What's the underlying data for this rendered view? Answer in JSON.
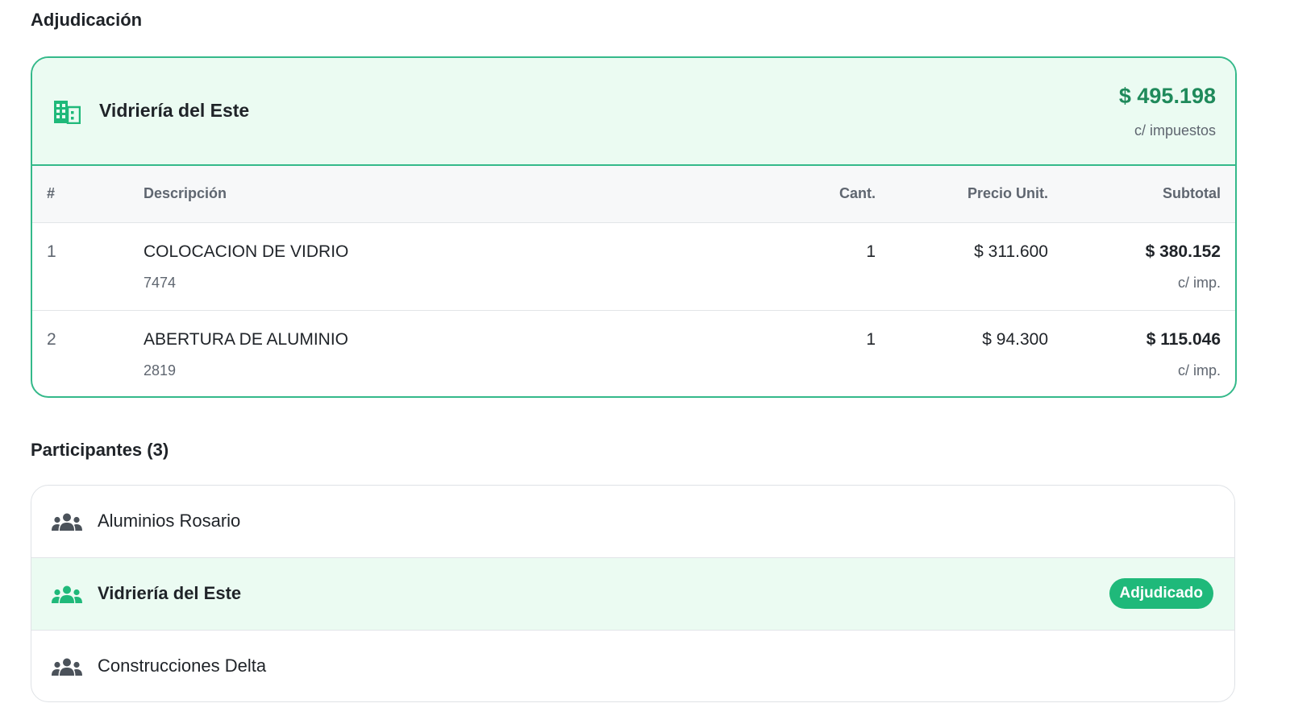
{
  "award": {
    "section_title": "Adjudicación",
    "vendor": "Vidriería del Este",
    "total": "$ 495.198",
    "tax_note": "c/ impuestos",
    "icon": "building-icon",
    "columns": {
      "num": "#",
      "desc": "Descripción",
      "qty": "Cant.",
      "price": "Precio Unit.",
      "subtotal": "Subtotal"
    },
    "items": [
      {
        "num": "1",
        "desc": "COLOCACION DE VIDRIO",
        "code": "7474",
        "qty": "1",
        "price": "$ 311.600",
        "subtotal": "$ 380.152",
        "subtotal_note": "c/ imp."
      },
      {
        "num": "2",
        "desc": "ABERTURA DE ALUMINIO",
        "code": "2819",
        "qty": "1",
        "price": "$ 94.300",
        "subtotal": "$ 115.046",
        "subtotal_note": "c/ imp."
      }
    ]
  },
  "participants": {
    "section_title": "Participantes (3)",
    "icon": "users-icon",
    "list": [
      {
        "name": "Aluminios Rosario"
      },
      {
        "name": "Vidriería del Este",
        "badge": "Adjudicado"
      },
      {
        "name": "Construcciones Delta"
      }
    ]
  },
  "colors": {
    "accent": "#1fb97a",
    "accent_dark": "#1f8a5b",
    "highlight_bg": "#ebfbf2",
    "border_green": "#34b98a"
  }
}
